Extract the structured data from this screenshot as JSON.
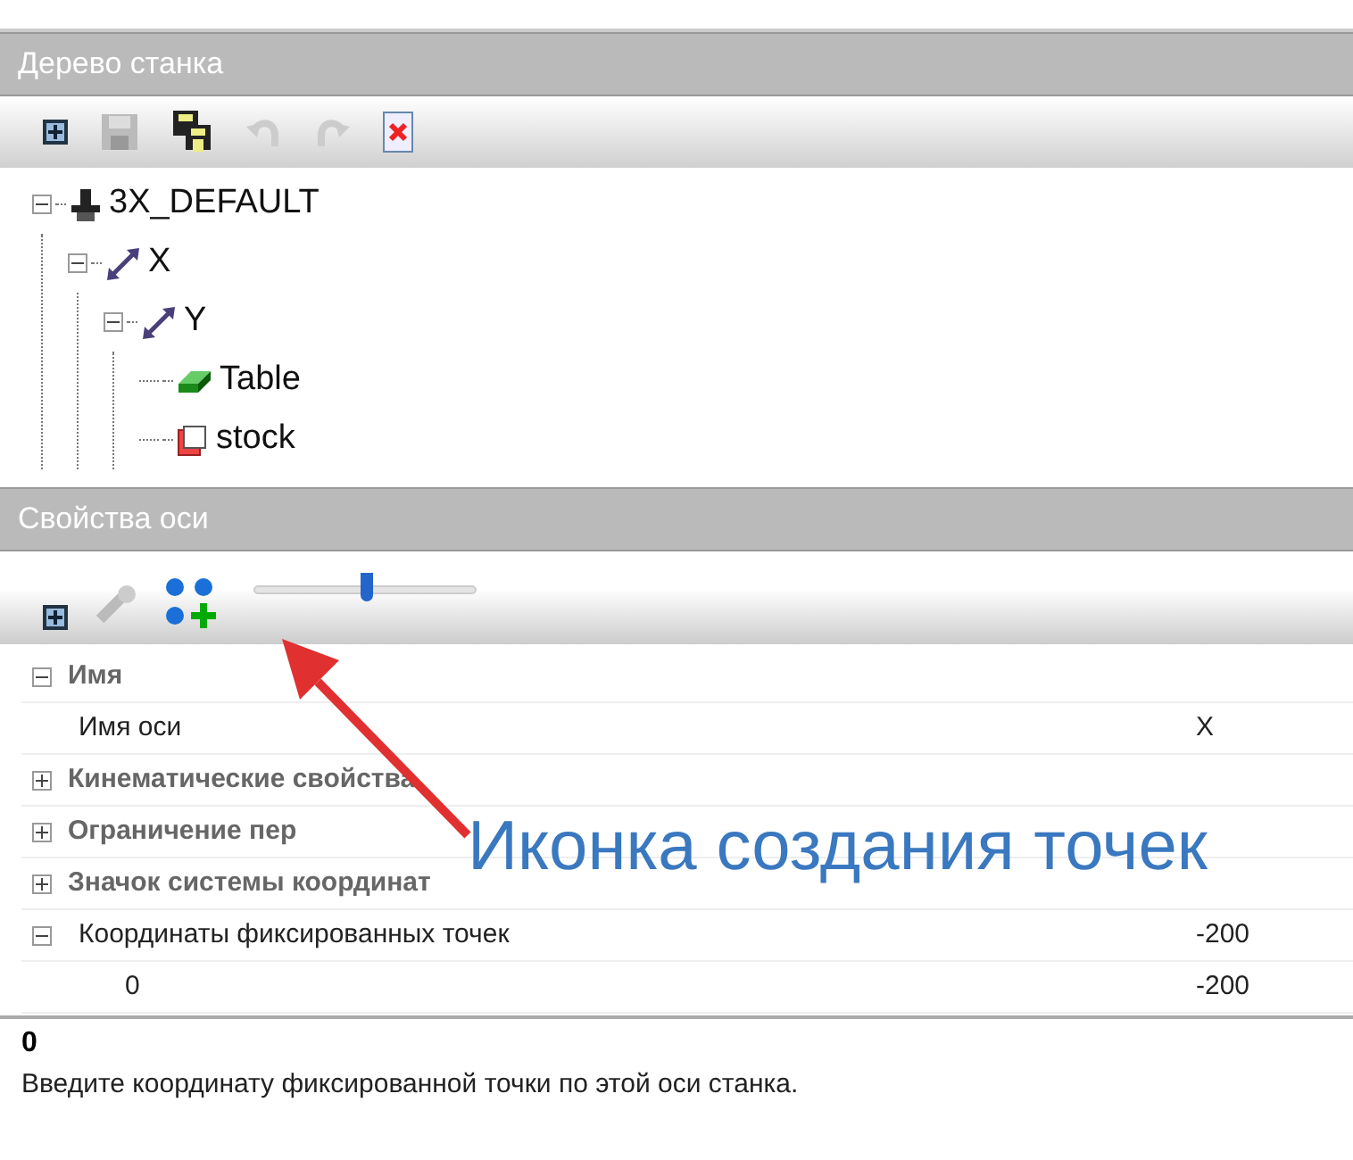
{
  "machine_tree": {
    "title": "Дерево станка",
    "nodes": [
      {
        "label": "3X_DEFAULT",
        "kind": "machine",
        "expanded": true,
        "children": [
          {
            "label": "X",
            "kind": "axis",
            "expanded": true,
            "children": [
              {
                "label": "Y",
                "kind": "axis",
                "expanded": true,
                "children": [
                  {
                    "label": "Table",
                    "kind": "table"
                  },
                  {
                    "label": "stock",
                    "kind": "stock"
                  }
                ]
              }
            ]
          }
        ]
      }
    ]
  },
  "axis_properties": {
    "title": "Свойства оси",
    "slider": {
      "level": 0.5
    },
    "rows": [
      {
        "kind": "category",
        "label": "Имя",
        "expanded": true
      },
      {
        "kind": "property",
        "label": "Имя оси",
        "value": "X"
      },
      {
        "kind": "category",
        "label": "Кинематические свойства",
        "expanded": false
      },
      {
        "kind": "category",
        "label": "Ограничение пер",
        "expanded": false
      },
      {
        "kind": "category",
        "label": "Значок системы координат",
        "expanded": false
      },
      {
        "kind": "group",
        "label": "Координаты фиксированных точек",
        "value": "-200",
        "expanded": true
      },
      {
        "kind": "item",
        "label": "0",
        "value": "-200"
      }
    ],
    "description": {
      "title": "0",
      "text": "Введите координату фиксированной точки по этой оси станка."
    }
  },
  "annotation": {
    "text": "Иконка создания точек"
  }
}
